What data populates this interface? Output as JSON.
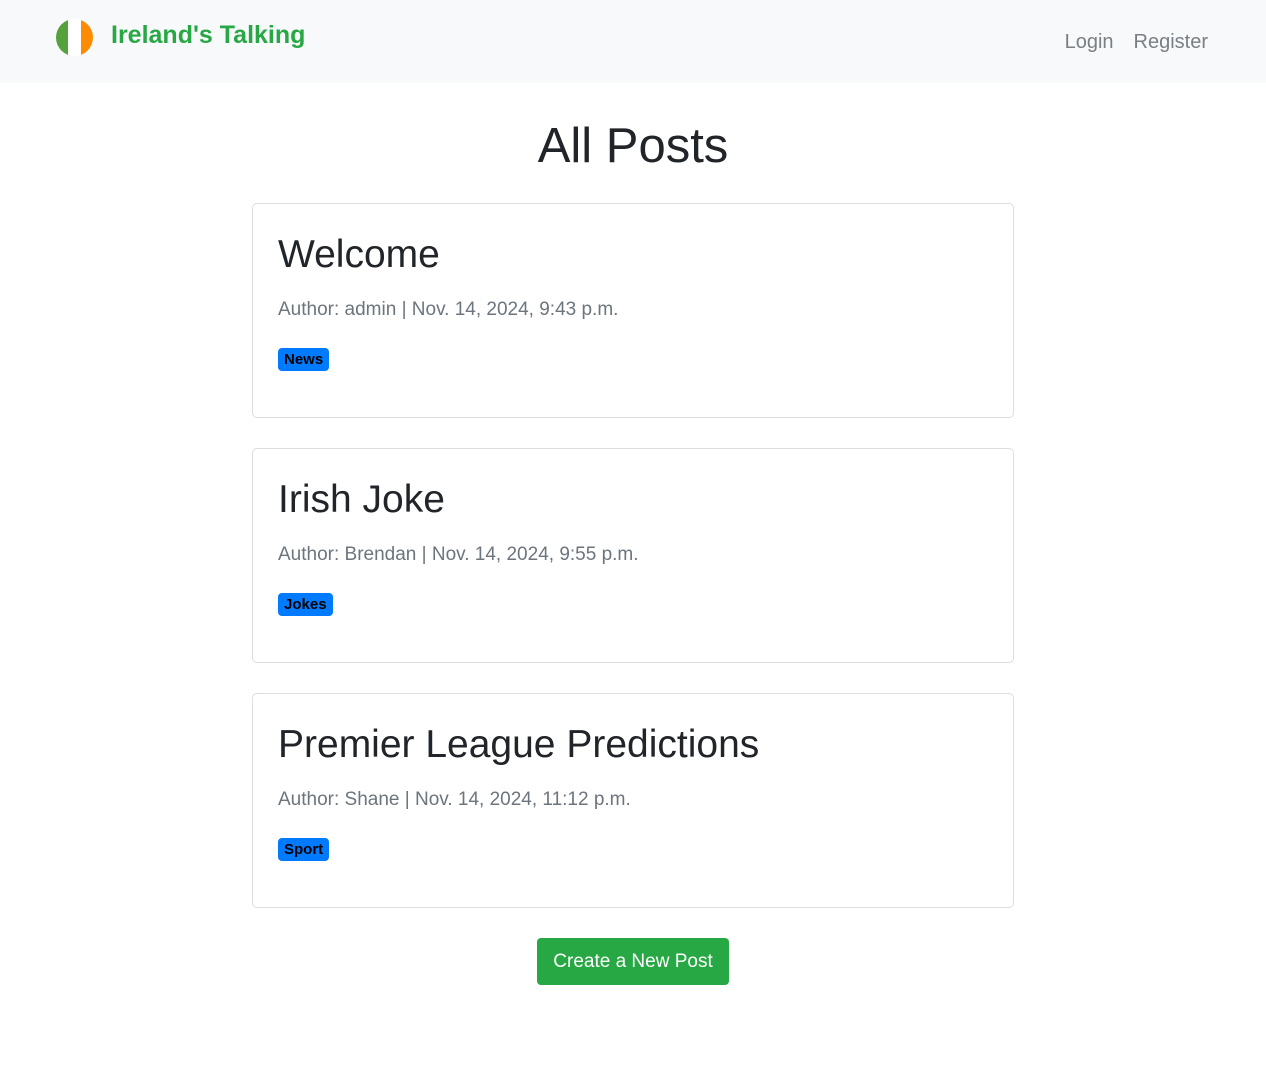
{
  "navbar": {
    "brand_title": "Ireland's Talking",
    "flag_colors": [
      "#55a13b",
      "#ffffff",
      "#ff8c00"
    ],
    "links": [
      {
        "label": "Login"
      },
      {
        "label": "Register"
      }
    ]
  },
  "main": {
    "title": "All Posts",
    "posts": [
      {
        "title": "Welcome",
        "meta": "Author: admin | Nov. 14, 2024, 9:43 p.m.",
        "category": "News"
      },
      {
        "title": "Irish Joke",
        "meta": "Author: Brendan | Nov. 14, 2024, 9:55 p.m.",
        "category": "Jokes"
      },
      {
        "title": "Premier League Predictions",
        "meta": "Author: Shane | Nov. 14, 2024, 11:12 p.m.",
        "category": "Sport"
      }
    ],
    "create_button_label": "Create a New Post"
  },
  "colors": {
    "brand": "#28a745",
    "badge": "#007bff",
    "navbar_bg": "#f8f9fa"
  }
}
